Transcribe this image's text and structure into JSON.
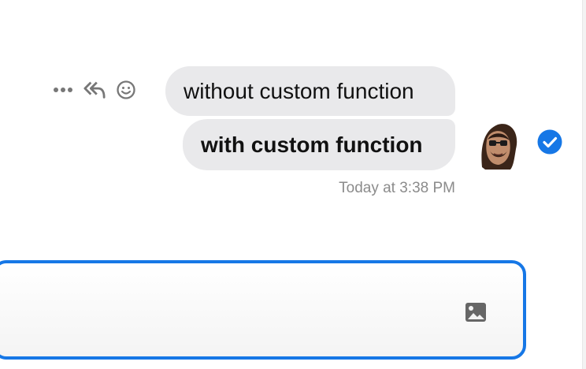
{
  "conversation": {
    "messages": [
      {
        "text": "without custom function"
      },
      {
        "text": "with custom function"
      }
    ],
    "timestamp": "Today at 3:38 PM"
  },
  "message_actions": [
    {
      "icon": "more-horizontal-icon"
    },
    {
      "icon": "reply-all-icon"
    },
    {
      "icon": "smiley-icon"
    }
  ],
  "status_icon": "check-circle-icon",
  "composer": {
    "value": "",
    "image_icon": "image-icon"
  },
  "colors": {
    "accent": "#1677e6",
    "bubble": "#e9e9eb",
    "muted_text": "#8b8b8b"
  }
}
